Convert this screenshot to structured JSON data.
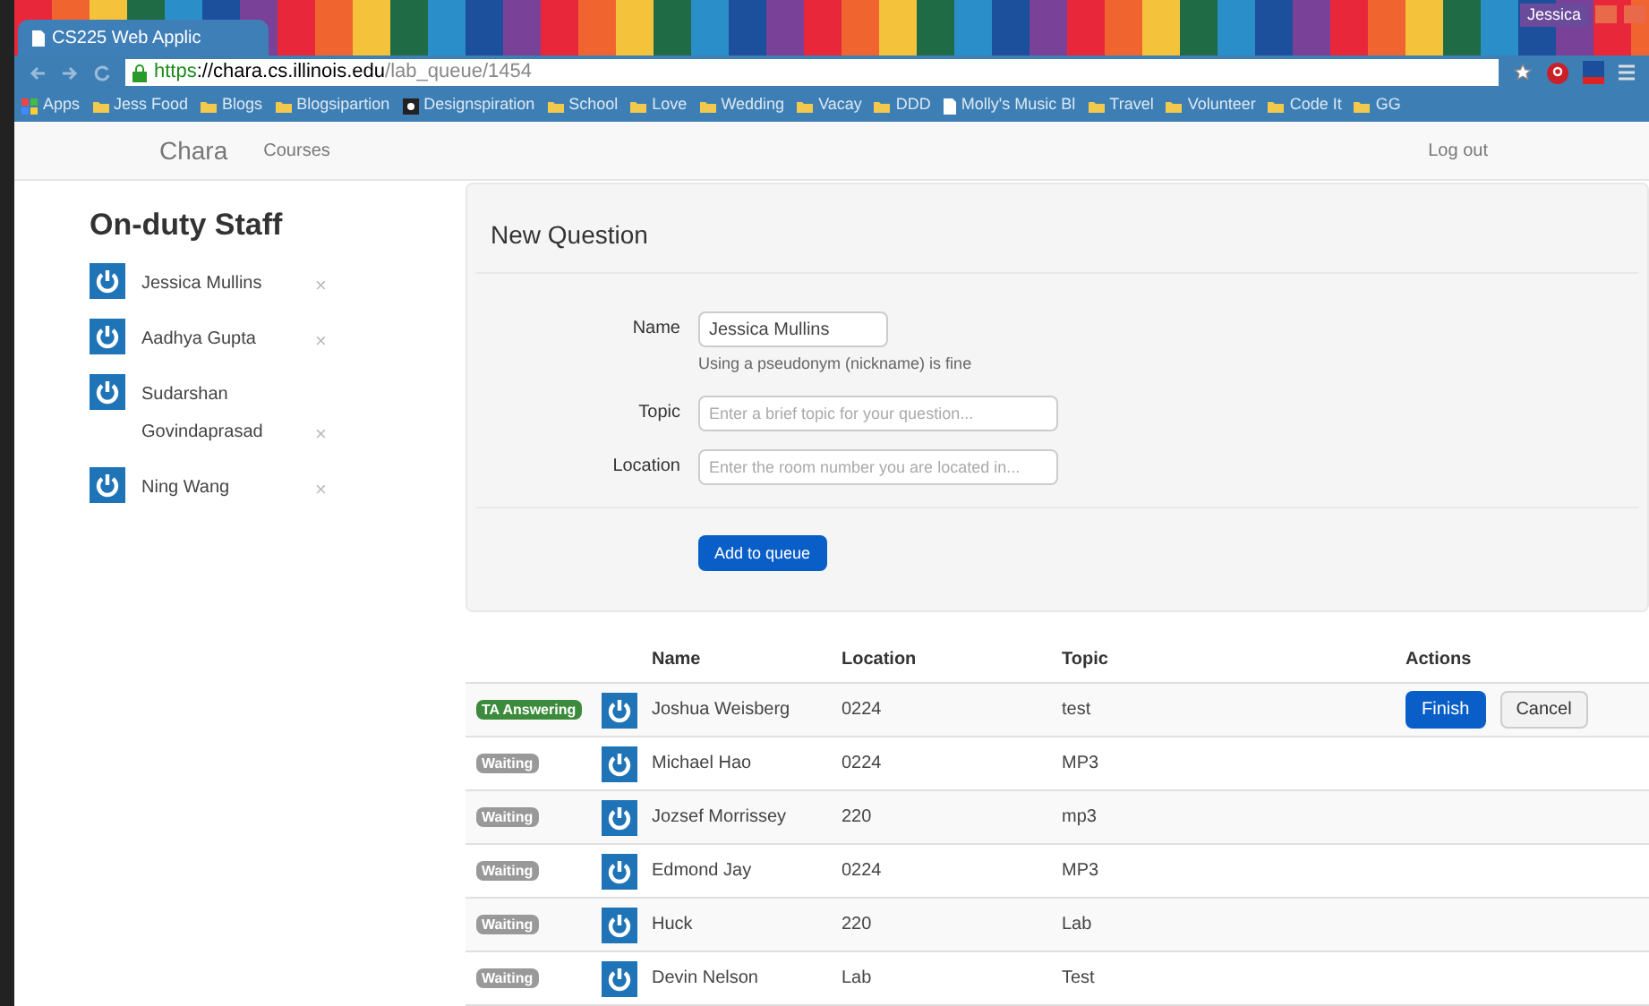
{
  "browser": {
    "tab_title": "CS225 Web Applic",
    "profile": "Jessica",
    "url_scheme": "https",
    "url_host": "://chara.cs.illinois.edu",
    "url_path": "/lab_queue/1454",
    "bookmarks": [
      {
        "kind": "apps",
        "label": "Apps"
      },
      {
        "kind": "folder",
        "label": "Jess Food"
      },
      {
        "kind": "folder",
        "label": "Blogs"
      },
      {
        "kind": "folder",
        "label": "Blogsipartion"
      },
      {
        "kind": "site",
        "label": "Designspiration"
      },
      {
        "kind": "folder",
        "label": "School"
      },
      {
        "kind": "folder",
        "label": "Love"
      },
      {
        "kind": "folder",
        "label": "Wedding"
      },
      {
        "kind": "folder",
        "label": "Vacay"
      },
      {
        "kind": "folder",
        "label": "DDD"
      },
      {
        "kind": "page",
        "label": "Molly's Music Bl"
      },
      {
        "kind": "folder",
        "label": "Travel"
      },
      {
        "kind": "folder",
        "label": "Volunteer"
      },
      {
        "kind": "folder",
        "label": "Code It"
      },
      {
        "kind": "folder",
        "label": "GG"
      }
    ]
  },
  "navbar": {
    "brand": "Chara",
    "links": [
      "Courses"
    ],
    "logout": "Log out"
  },
  "staff": {
    "title": "On-duty Staff",
    "members": [
      {
        "name": "Jessica Mullins",
        "remove": "×"
      },
      {
        "name": "Aadhya Gupta",
        "remove": "×"
      },
      {
        "name": "Sudarshan Govindaprasad",
        "remove": "×"
      },
      {
        "name": "Ning Wang",
        "remove": "×"
      }
    ]
  },
  "new_question": {
    "title": "New Question",
    "name": {
      "label": "Name",
      "value": "Jessica Mullins",
      "help": "Using a pseudonym (nickname) is fine"
    },
    "topic": {
      "label": "Topic",
      "placeholder": "Enter a brief topic for your question..."
    },
    "location": {
      "label": "Location",
      "placeholder": "Enter the room number you are located in..."
    },
    "submit": "Add to queue"
  },
  "queue": {
    "columns": [
      "Name",
      "Location",
      "Topic",
      "Actions"
    ],
    "rows": [
      {
        "status": "TA Answering",
        "kind": "answering",
        "name": "Joshua Weisberg",
        "location": "0224",
        "topic": "test",
        "actions": [
          "Finish",
          "Cancel"
        ]
      },
      {
        "status": "Waiting",
        "kind": "waiting",
        "name": "Michael Hao",
        "location": "0224",
        "topic": "MP3"
      },
      {
        "status": "Waiting",
        "kind": "waiting",
        "name": "Jozsef Morrissey",
        "location": "220",
        "topic": "mp3"
      },
      {
        "status": "Waiting",
        "kind": "waiting",
        "name": "Edmond Jay",
        "location": "0224",
        "topic": "MP3"
      },
      {
        "status": "Waiting",
        "kind": "waiting",
        "name": "Huck",
        "location": "220",
        "topic": "Lab"
      },
      {
        "status": "Waiting",
        "kind": "waiting",
        "name": "Devin Nelson",
        "location": "Lab",
        "topic": "Test"
      }
    ]
  }
}
